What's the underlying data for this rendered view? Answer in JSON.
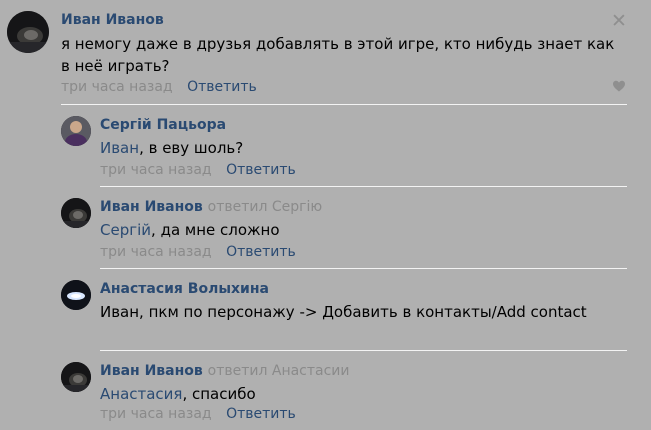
{
  "main_comment": {
    "author": "Иван Иванов",
    "text": "я немогу даже в друзья добавлять в этой игре, кто нибудь знает как в неё играть?",
    "time": "три часа назад",
    "reply_label": "Ответить",
    "close_symbol": "✕",
    "icons": {
      "close": "close-icon",
      "like": "heart-icon",
      "avatar": "avatar"
    }
  },
  "replies": [
    {
      "author": "Сергій Пацьора",
      "replied_to": "",
      "mention": "Иван",
      "text": ", в еву шоль?",
      "time": "три часа назад",
      "reply_label": "Ответить"
    },
    {
      "author": "Иван Иванов",
      "replied_to": "ответил Сергію",
      "mention": "Сергій",
      "text": ", да мне сложно",
      "time": "три часа назад",
      "reply_label": "Ответить"
    },
    {
      "author": "Анастасия Волыхина",
      "replied_to": "",
      "mention": "",
      "text": "Иван, пкм по персонажу -> Добавить в контакты/Add contact",
      "time": "",
      "reply_label": ""
    },
    {
      "author": "Иван Иванов",
      "replied_to": "ответил Анастасии",
      "mention": "Анастасия",
      "text": ", спасибо",
      "time": "три часа назад",
      "reply_label": "Ответить"
    }
  ],
  "colors": {
    "background": "#b0b0b0",
    "link": "#2a4a72",
    "muted": "#8a8a8a",
    "divider": "#f3f3f3"
  }
}
